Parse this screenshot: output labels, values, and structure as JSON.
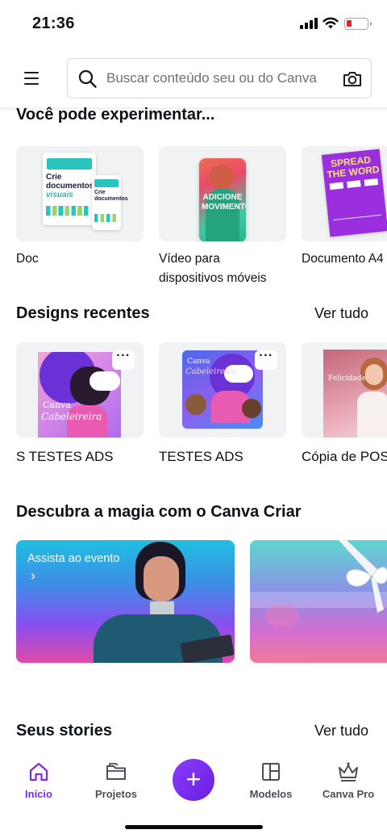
{
  "status_bar": {
    "time": "21:36"
  },
  "header": {
    "search_placeholder": "Buscar conteúdo seu ou do Canva",
    "icons": [
      "menu-icon",
      "search-icon",
      "camera-icon"
    ]
  },
  "suggestions": {
    "title": "Você pode experimentar...",
    "items": [
      {
        "label": "Doc",
        "thumb_text": [
          "Crie",
          "documentos",
          "visuais"
        ]
      },
      {
        "label": "Vídeo para dispositivos móveis",
        "label_lines": [
          "Vídeo para",
          "dispositivos móveis"
        ],
        "thumb_text": [
          "ADICIONE",
          "MOVIMENTO"
        ]
      },
      {
        "label": "Documento A4",
        "thumb_text": [
          "SPREAD",
          "THE WORD"
        ]
      }
    ]
  },
  "recent_designs": {
    "title": "Designs recentes",
    "see_all": "Ver tudo",
    "items": [
      {
        "label": "S TESTES ADS",
        "thumb_text": [
          "Canva",
          "Cabeleireira"
        ],
        "more": "···"
      },
      {
        "label": "TESTES ADS",
        "thumb_text": [
          "Canva",
          "Cabeleireira"
        ],
        "more": "···"
      },
      {
        "label": "Cópia de POS",
        "thumb_text": [
          "Felicidade"
        ]
      }
    ]
  },
  "discover": {
    "title": "Descubra a magia com o Canva Criar",
    "banner": {
      "text": "Assista ao evento",
      "arrow": "›"
    }
  },
  "stories": {
    "title": "Seus stories",
    "see_all": "Ver tudo"
  },
  "bottom_nav": {
    "items": [
      {
        "label": "Início",
        "icon": "home-icon",
        "active": true
      },
      {
        "label": "Projetos",
        "icon": "folder-icon",
        "active": false
      },
      {
        "label": "Modelos",
        "icon": "templates-icon",
        "active": false
      },
      {
        "label": "Canva Pro",
        "icon": "crown-icon",
        "active": false
      }
    ],
    "create_button": "+",
    "accent_color": "#7d2ae8"
  }
}
